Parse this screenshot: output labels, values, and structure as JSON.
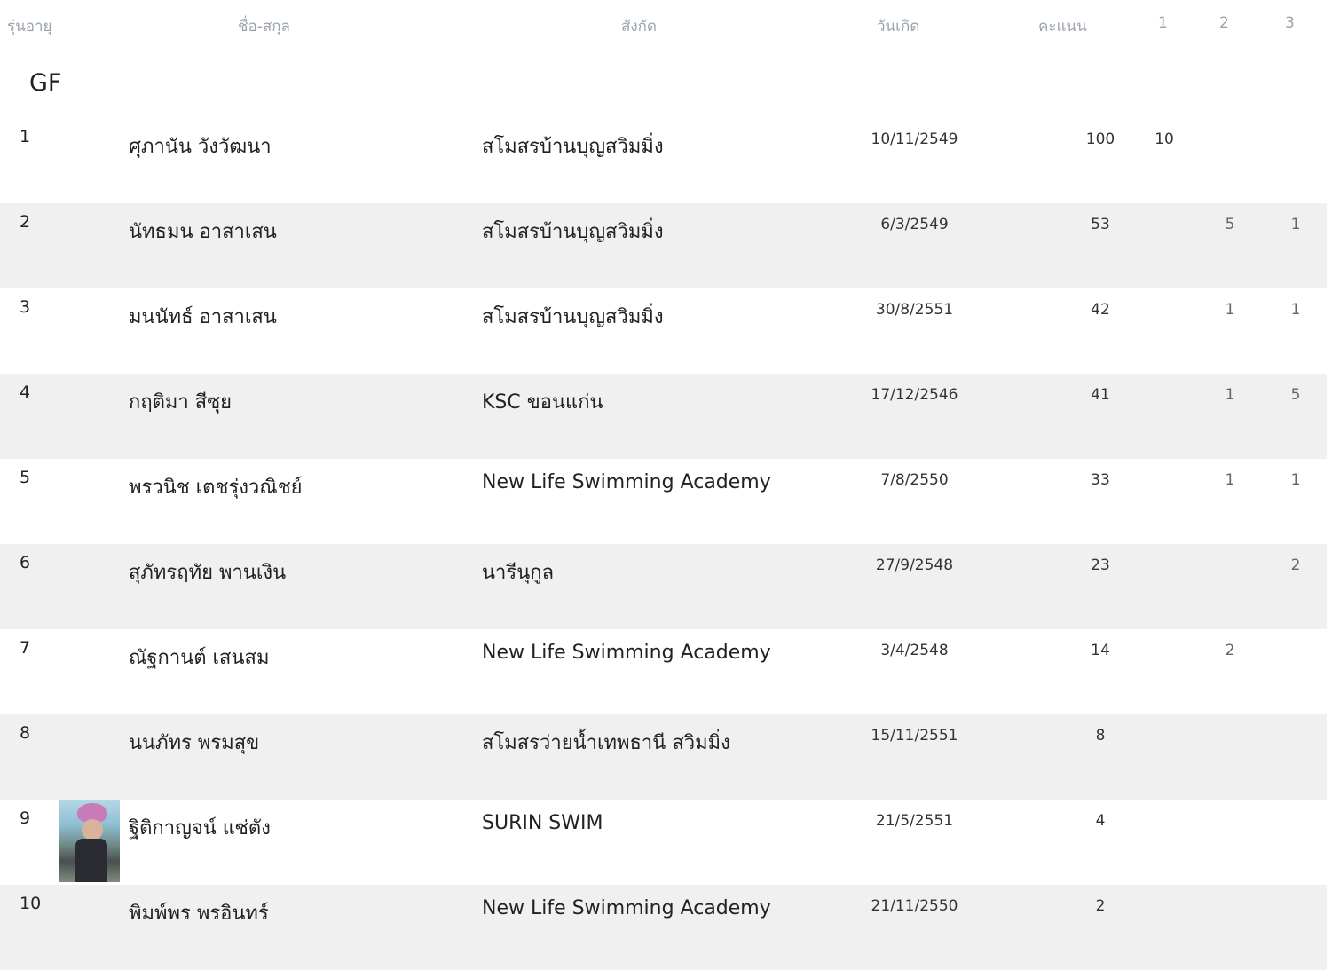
{
  "header": {
    "age_group": "รุ่นอายุ",
    "name": "ชื่อ-สกุล",
    "club": "สังกัด",
    "dob": "วันเกิด",
    "score": "คะแนน",
    "col1": "1",
    "col2": "2",
    "col3": "3"
  },
  "group": {
    "title": "GF"
  },
  "rows": [
    {
      "rank": "1",
      "name": "ศุภานัน วังวัฒนา",
      "club": "สโมสรบ้านบุญสวิมมิ่ง",
      "dob": "10/11/2549",
      "score": "100",
      "c1": "10",
      "c2": "",
      "c3": ""
    },
    {
      "rank": "2",
      "name": "นัทธมน อาสาเสน",
      "club": "สโมสรบ้านบุญสวิมมิ่ง",
      "dob": "6/3/2549",
      "score": "53",
      "c1": "",
      "c2": "5",
      "c3": "1"
    },
    {
      "rank": "3",
      "name": "มนนัทธ์ อาสาเสน",
      "club": "สโมสรบ้านบุญสวิมมิ่ง",
      "dob": "30/8/2551",
      "score": "42",
      "c1": "",
      "c2": "1",
      "c3": "1"
    },
    {
      "rank": "4",
      "name": "กฤติมา สีซุย",
      "club": "KSC ขอนแก่น",
      "dob": "17/12/2546",
      "score": "41",
      "c1": "",
      "c2": "1",
      "c3": "5"
    },
    {
      "rank": "5",
      "name": "พรวนิช เตชรุ่งวณิชย์",
      "club": "New Life Swimming Academy",
      "dob": "7/8/2550",
      "score": "33",
      "c1": "",
      "c2": "1",
      "c3": "1"
    },
    {
      "rank": "6",
      "name": "สุภัทรฤทัย พานเงิน",
      "club": "นารีนุกูล",
      "dob": "27/9/2548",
      "score": "23",
      "c1": "",
      "c2": "",
      "c3": "2"
    },
    {
      "rank": "7",
      "name": "ณัฐกานต์ เสนสม",
      "club": "New Life Swimming Academy",
      "dob": "3/4/2548",
      "score": "14",
      "c1": "",
      "c2": "2",
      "c3": ""
    },
    {
      "rank": "8",
      "name": "นนภัทร พรมสุข",
      "club": "สโมสรว่ายน้ำเทพธานี สวิมมิ่ง",
      "dob": "15/11/2551",
      "score": "8",
      "c1": "",
      "c2": "",
      "c3": ""
    },
    {
      "rank": "9",
      "name": "ฐิติกาญจน์ แซ่ตัง",
      "club": "SURIN SWIM",
      "dob": "21/5/2551",
      "score": "4",
      "c1": "",
      "c2": "",
      "c3": ""
    },
    {
      "rank": "10",
      "name": "พิมพ์พร พรอินทร์",
      "club": "New Life Swimming Academy",
      "dob": "21/11/2550",
      "score": "2",
      "c1": "",
      "c2": "",
      "c3": ""
    }
  ]
}
